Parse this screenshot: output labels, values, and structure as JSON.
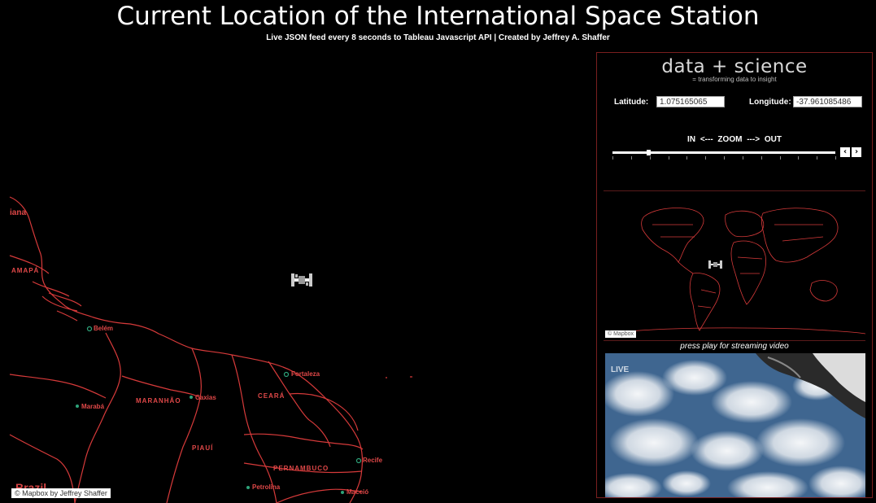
{
  "header": {
    "title": "Current Location of the International Space Station",
    "subtitle": "Live JSON feed every 8 seconds to Tableau Javascript API | Created by Jeffrey A. Shaffer"
  },
  "map": {
    "attribution": "© Mapbox by Jeffrey Shaffer",
    "regions": {
      "iana": "iana",
      "amapa": "AMAPÁ",
      "maranhao": "MARANHÃO",
      "ceara": "CEARÁ",
      "piaui": "PIAUÍ",
      "pernambuco": "PERNAMBUCO",
      "brazil": "Brazil"
    },
    "cities": {
      "belem": "Belém",
      "fortaleza": "Fortaleza",
      "caxias": "Caxias",
      "maraba": "Marabá",
      "recife": "Recife",
      "petrolina": "Petrolina",
      "maceio": "Maceió"
    },
    "colors": {
      "borders": "#d63a3a",
      "labels": "#e04848",
      "city_dot": "#2ea37a"
    },
    "marker_icon": "iss-icon"
  },
  "panel": {
    "logo": "data + science",
    "tagline": "= transforming data to insight",
    "latitude_label": "Latitude:",
    "latitude_value": "1.075165065",
    "longitude_label": "Longitude:",
    "longitude_value": "-37.961085486",
    "zoom_label": "IN  <---   ZOOM   --->  OUT",
    "zoom_level_fraction": 0.16,
    "minimap_attribution": "© Mapbox",
    "video_caption": "press play for streaming video",
    "video_live_label": "LIVE"
  }
}
